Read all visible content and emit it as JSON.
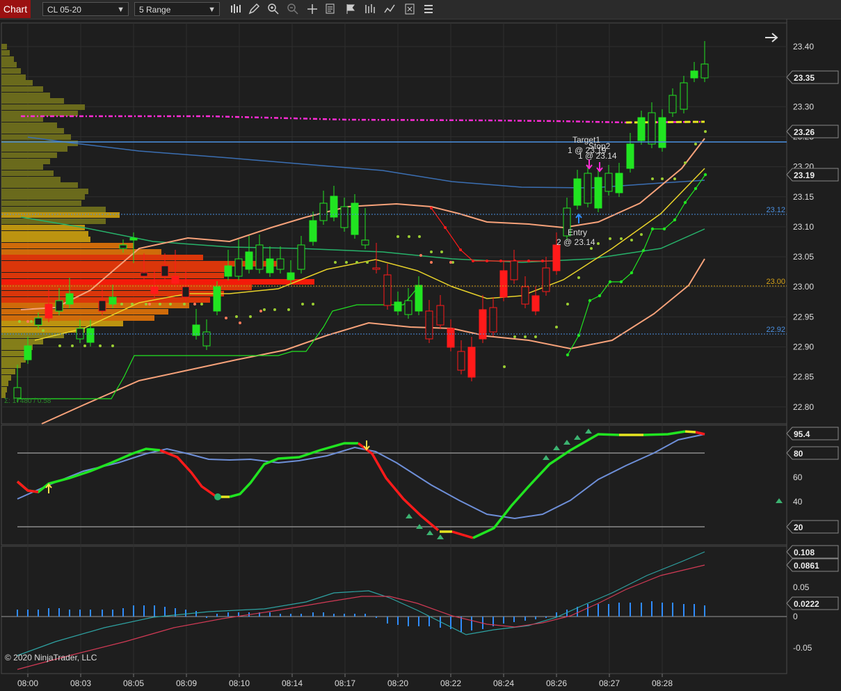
{
  "toolbar": {
    "tab_label": "Chart",
    "instrument": "CL 05-20",
    "bar_type": "5 Range",
    "icons": [
      "bar-type-icon",
      "draw-pencil-icon",
      "zoom-in-icon",
      "zoom-out-icon",
      "crosshair-icon",
      "data-box-icon",
      "strategy-icon",
      "indicators-icon",
      "chart-trader-icon",
      "properties-icon",
      "menu-icon"
    ]
  },
  "price_axis": {
    "ticks": [
      "23.40",
      "23.35",
      "23.30",
      "23.25",
      "23.20",
      "23.15",
      "23.10",
      "23.05",
      "23.00",
      "22.95",
      "22.90",
      "22.85",
      "22.80"
    ],
    "last_price": "23.35",
    "marker_1": "23.26",
    "marker_2": "23.19",
    "line_label_1": "23.12",
    "line_label_2": "23.00",
    "line_label_3": "22.92"
  },
  "annotations": {
    "target_title": "Target1",
    "target_value": "1 @ 23.19",
    "stop_title": "Stop2",
    "stop_value": "1 @ 23.14",
    "entry_title": "Entry",
    "entry_value": "2 @ 23.14",
    "volume_profile_label": "Σ: 17480 / 0.58"
  },
  "stochastic_panel": {
    "current": "95.4",
    "upper": "80",
    "ticks": [
      "60",
      "40"
    ],
    "lower": "20"
  },
  "macd_panel": {
    "val_1": "0.108",
    "val_2": "0.0861",
    "tick_1": "0.05",
    "val_3": "0.0222",
    "tick_2": "0",
    "tick_3": "-0.05"
  },
  "time_axis": [
    "08:00",
    "08:03",
    "08:05",
    "08:09",
    "08:10",
    "08:14",
    "08:17",
    "08:20",
    "08:22",
    "08:24",
    "08:26",
    "08:27",
    "08:28"
  ],
  "copyright": "© 2020 NinjaTrader, LLC",
  "colors": {
    "up": "#21e421",
    "down": "#ff1a1a",
    "hline": "#4a90e2",
    "profile_poc": "#ff0000",
    "ema_slow": "#3b6fb3",
    "stoch_k": "#21e421",
    "stoch_d": "#6e8fd8",
    "macd_hist": "#2f8cff"
  }
}
